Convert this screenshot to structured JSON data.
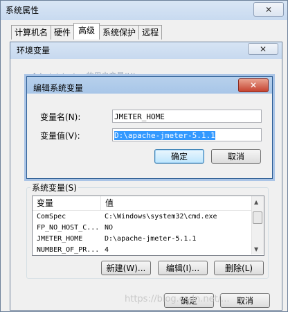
{
  "outer_window": {
    "title": "系统属性",
    "close_label": "✕"
  },
  "tabs": [
    {
      "label": "计算机名"
    },
    {
      "label": "硬件"
    },
    {
      "label": "高级"
    },
    {
      "label": "系统保护"
    },
    {
      "label": "远程"
    }
  ],
  "env_window": {
    "title": "环境变量",
    "close_label": "✕",
    "user_vars_label": "Administrator 的用户变量(U)",
    "system_vars_label": "系统变量(S)",
    "columns": [
      "变量",
      "值"
    ],
    "rows": [
      {
        "name": "ComSpec",
        "value": "C:\\Windows\\system32\\cmd.exe"
      },
      {
        "name": "FP_NO_HOST_C...",
        "value": "NO"
      },
      {
        "name": "JMETER_HOME",
        "value": "D:\\apache-jmeter-5.1.1"
      },
      {
        "name": "NUMBER_OF_PR...",
        "value": "4"
      }
    ],
    "new_button": "新建(W)...",
    "edit_button": "编辑(I)...",
    "delete_button": "删除(L)",
    "ok_button": "确定",
    "cancel_button": "取消"
  },
  "edit_dialog": {
    "title": "编辑系统变量",
    "close_label": "✕",
    "name_label": "变量名(N):",
    "value_label": "变量值(V):",
    "name_value": "JMETER_HOME",
    "value_value": "D:\\apache-jmeter-5.1.1",
    "ok_button": "确定",
    "cancel_button": "取消"
  },
  "watermark": "https://blog.csdn.net/..."
}
